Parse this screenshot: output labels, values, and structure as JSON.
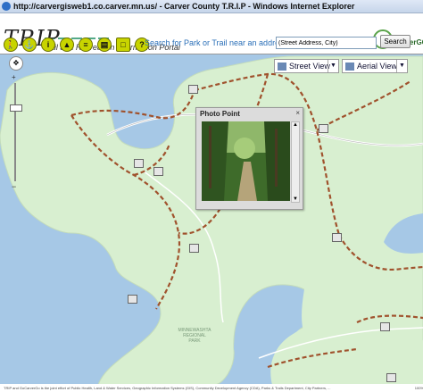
{
  "window": {
    "title": "http://carvergisweb1.co.carver.mn.us/ - Carver County T.R.I.P - Windows Internet Explorer"
  },
  "header": {
    "logo_main": "TRIP",
    "logo_sub": "Trail and Recreation Information Portal",
    "partner_logo": "GoCarverGO"
  },
  "toolbar": {
    "icons": [
      "hiker-icon",
      "boat-icon",
      "info-icon",
      "tent-icon",
      "list-icon",
      "print-icon",
      "layers-icon",
      "help-icon"
    ],
    "search_label": "Search for Park or Trail near an address:",
    "search_value": "(Street Address, City)",
    "search_button": "Search"
  },
  "map": {
    "view_street": "Street View",
    "view_aerial": "Aerial View",
    "popup_title": "Photo Point",
    "popup_close": "×",
    "park_label_lines": [
      "MINNEWASHTA",
      "REGIONAL",
      "PARK"
    ],
    "colors": {
      "water": "#a6c8e6",
      "land": "#d8efd0",
      "trail": "#a0522d",
      "road": "#ffffff"
    }
  },
  "footer": {
    "text": "TRIP and GoCarverGo is the joint effort of Public Health, Land & Water Services, Geographic Information Systems (GIS), Community Development Agency (CDA), Parks & Trails Department, City Partners, ...",
    "zoom": "100%"
  }
}
